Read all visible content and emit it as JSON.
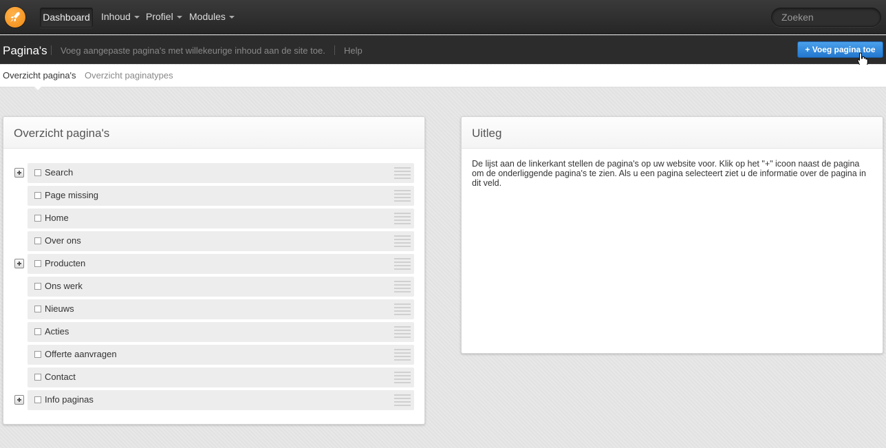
{
  "navbar": {
    "logo_icon": "rocket-icon",
    "items": [
      {
        "label": "Dashboard",
        "active": true
      },
      {
        "label": "Inhoud",
        "dropdown": true
      },
      {
        "label": "Profiel",
        "dropdown": true
      },
      {
        "label": "Modules",
        "dropdown": true
      }
    ],
    "search_placeholder": "Zoeken"
  },
  "subheader": {
    "title": "Pagina's",
    "description": "Voeg aangepaste pagina's met willekeurige inhoud aan de site toe.",
    "help": "Help",
    "add_button": "+ Voeg pagina toe"
  },
  "tabs": [
    {
      "label": "Overzicht pagina's",
      "active": true
    },
    {
      "label": "Overzicht paginatypes",
      "active": false
    }
  ],
  "left_panel": {
    "title": "Overzicht pagina's",
    "pages": [
      {
        "label": "Search",
        "expandable": true
      },
      {
        "label": "Page missing",
        "expandable": false
      },
      {
        "label": "Home",
        "expandable": false
      },
      {
        "label": "Over ons",
        "expandable": false
      },
      {
        "label": "Producten",
        "expandable": true
      },
      {
        "label": "Ons werk",
        "expandable": false
      },
      {
        "label": "Nieuws",
        "expandable": false
      },
      {
        "label": "Acties",
        "expandable": false
      },
      {
        "label": "Offerte aanvragen",
        "expandable": false
      },
      {
        "label": "Contact",
        "expandable": false
      },
      {
        "label": "Info paginas",
        "expandable": true
      }
    ]
  },
  "right_panel": {
    "title": "Uitleg",
    "text": "De lijst aan de linkerkant stellen de pagina's op uw website voor. Klik op het \"+\" icoon naast de pagina om de onderliggende pagina's te zien. Als u een pagina selecteert ziet u de informatie over de pagina in dit veld."
  },
  "colors": {
    "accent": "#2f86db",
    "navbar": "#2e2e2e",
    "logo": "#f39a1e"
  }
}
